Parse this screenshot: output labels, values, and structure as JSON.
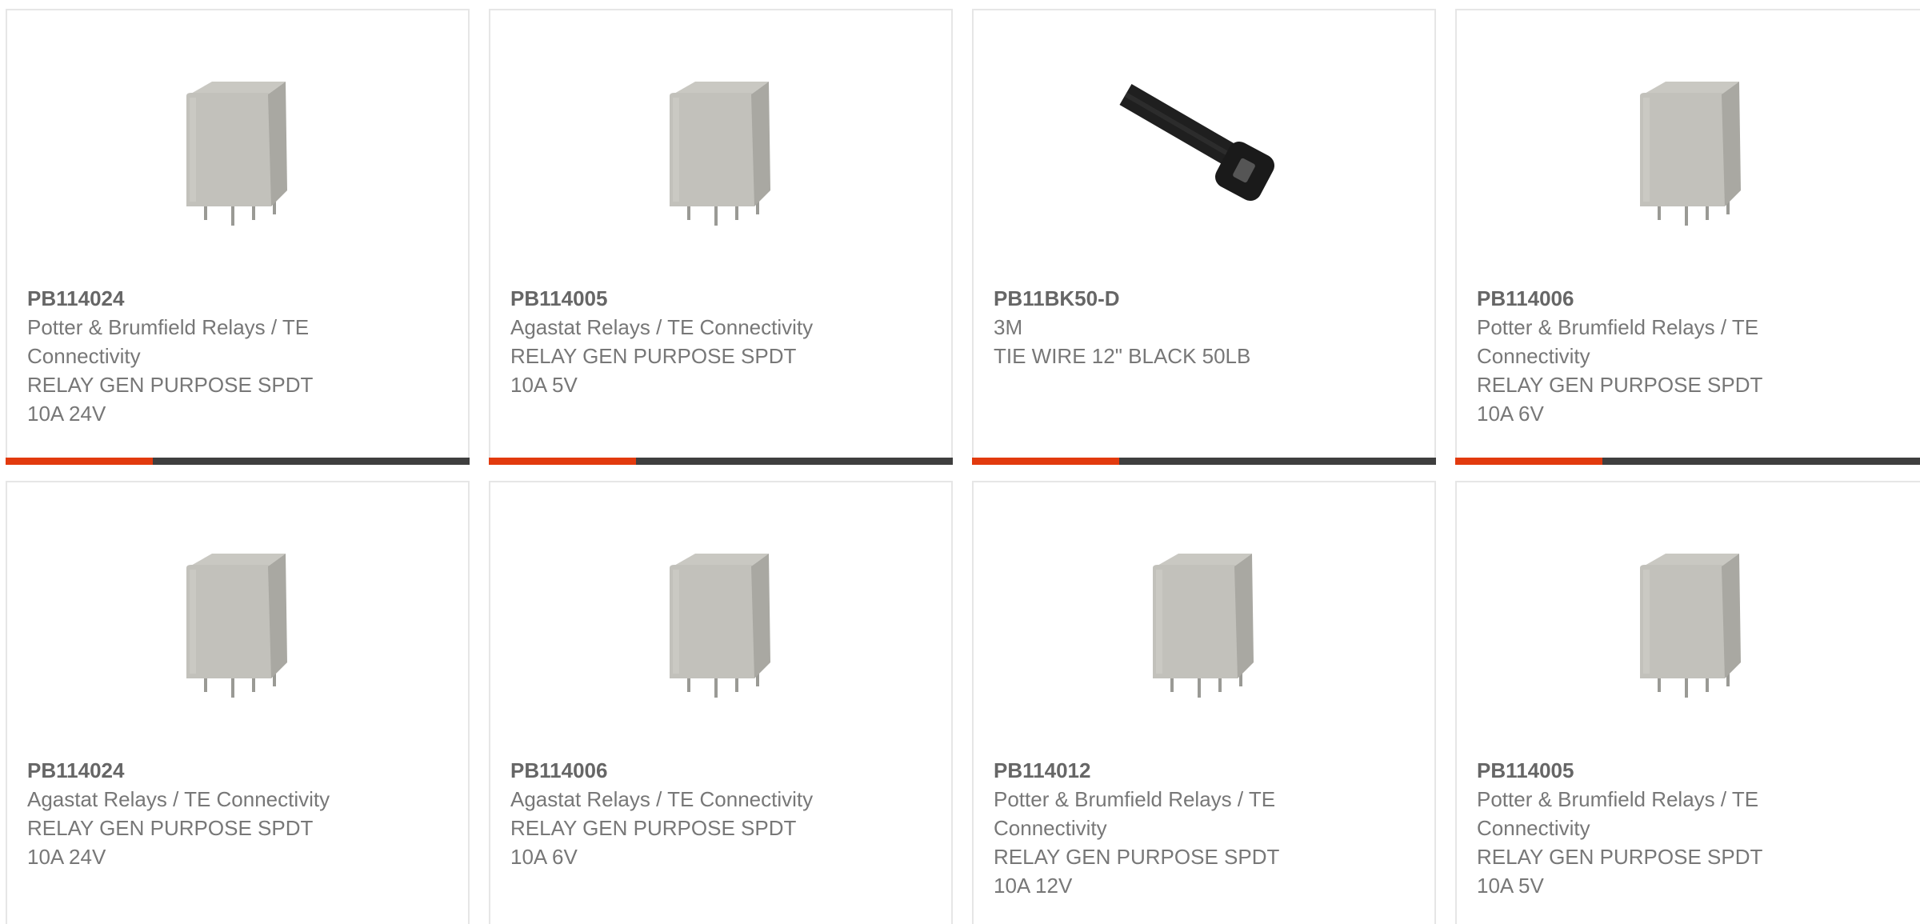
{
  "products": [
    {
      "part_number": "PB114024",
      "manufacturer": "Potter & Brumfield Relays / TE Connectivity",
      "manufacturer_lines": [
        "Potter & Brumfield Relays / TE",
        "Connectivity"
      ],
      "description_lines": [
        "RELAY GEN PURPOSE SPDT",
        "10A 24V"
      ],
      "image": "relay-image"
    },
    {
      "part_number": "PB114005",
      "manufacturer": "Agastat Relays / TE Connectivity",
      "manufacturer_lines": [
        "Agastat Relays / TE Connectivity"
      ],
      "description_lines": [
        "RELAY GEN PURPOSE SPDT",
        "10A 5V"
      ],
      "image": "relay-image"
    },
    {
      "part_number": "PB11BK50-D",
      "manufacturer": "3M",
      "manufacturer_lines": [
        "3M"
      ],
      "description_lines": [
        "TIE WIRE 12\" BLACK 50LB"
      ],
      "image": "cable-tie-image"
    },
    {
      "part_number": "PB114006",
      "manufacturer": "Potter & Brumfield Relays / TE Connectivity",
      "manufacturer_lines": [
        "Potter & Brumfield Relays / TE",
        "Connectivity"
      ],
      "description_lines": [
        "RELAY GEN PURPOSE SPDT",
        "10A 6V"
      ],
      "image": "relay-image"
    },
    {
      "part_number": "PB114024",
      "manufacturer": "Agastat Relays / TE Connectivity",
      "manufacturer_lines": [
        "Agastat Relays / TE Connectivity"
      ],
      "description_lines": [
        "RELAY GEN PURPOSE SPDT",
        "10A 24V"
      ],
      "image": "relay-image"
    },
    {
      "part_number": "PB114006",
      "manufacturer": "Agastat Relays / TE Connectivity",
      "manufacturer_lines": [
        "Agastat Relays / TE Connectivity"
      ],
      "description_lines": [
        "RELAY GEN PURPOSE SPDT",
        "10A 6V"
      ],
      "image": "relay-image"
    },
    {
      "part_number": "PB114012",
      "manufacturer": "Potter & Brumfield Relays / TE Connectivity",
      "manufacturer_lines": [
        "Potter & Brumfield Relays / TE",
        "Connectivity"
      ],
      "description_lines": [
        "RELAY GEN PURPOSE SPDT",
        "10A 12V"
      ],
      "image": "relay-image"
    },
    {
      "part_number": "PB114005",
      "manufacturer": "Potter & Brumfield Relays / TE Connectivity",
      "manufacturer_lines": [
        "Potter & Brumfield Relays / TE",
        "Connectivity"
      ],
      "description_lines": [
        "RELAY GEN PURPOSE SPDT",
        "10A 5V"
      ],
      "image": "relay-image"
    }
  ],
  "colors": {
    "accent": "#e23a0e",
    "bar": "#3f3f3f",
    "border": "#e6e6e6",
    "text": "#777777"
  }
}
